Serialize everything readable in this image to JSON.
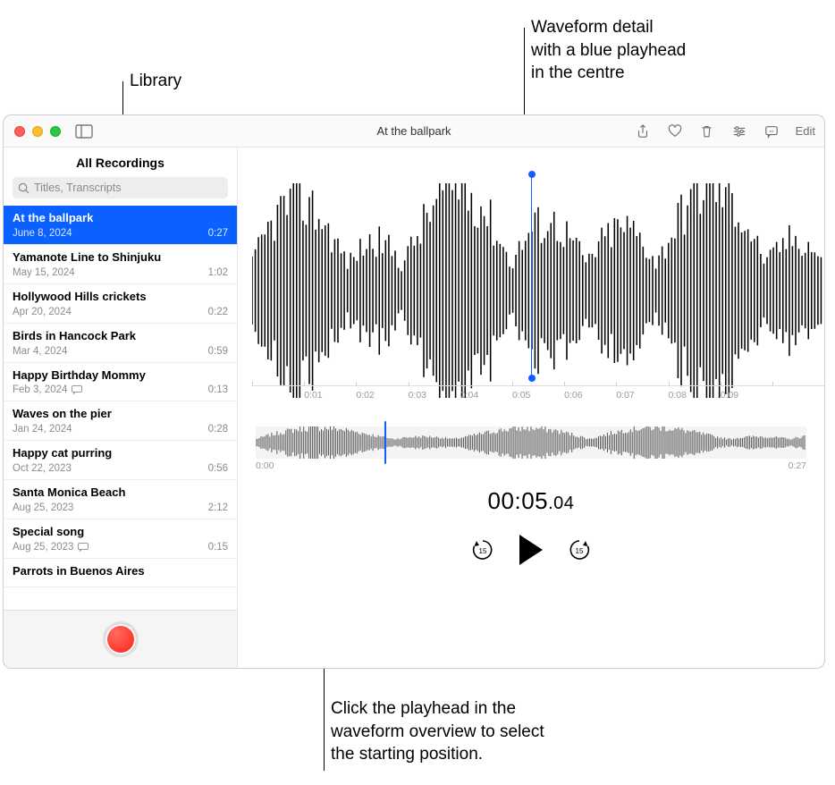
{
  "annotations": {
    "library": "Library",
    "waveform_detail": "Waveform detail\nwith a blue playhead\nin the centre",
    "overview_hint": "Click the playhead in the\nwaveform overview to select\nthe starting position."
  },
  "window": {
    "title": "At the ballpark",
    "edit_label": "Edit"
  },
  "sidebar": {
    "header": "All Recordings",
    "search_placeholder": "Titles, Transcripts",
    "recordings": [
      {
        "title": "At the ballpark",
        "date": "June 8, 2024",
        "duration": "0:27",
        "selected": true,
        "transcript": false
      },
      {
        "title": "Yamanote Line to Shinjuku",
        "date": "May 15, 2024",
        "duration": "1:02",
        "selected": false,
        "transcript": false
      },
      {
        "title": "Hollywood Hills crickets",
        "date": "Apr 20, 2024",
        "duration": "0:22",
        "selected": false,
        "transcript": false
      },
      {
        "title": "Birds in Hancock Park",
        "date": "Mar 4, 2024",
        "duration": "0:59",
        "selected": false,
        "transcript": false
      },
      {
        "title": "Happy Birthday Mommy",
        "date": "Feb 3, 2024",
        "duration": "0:13",
        "selected": false,
        "transcript": true
      },
      {
        "title": "Waves on the pier",
        "date": "Jan 24, 2024",
        "duration": "0:28",
        "selected": false,
        "transcript": false
      },
      {
        "title": "Happy cat purring",
        "date": "Oct 22, 2023",
        "duration": "0:56",
        "selected": false,
        "transcript": false
      },
      {
        "title": "Santa Monica Beach",
        "date": "Aug 25, 2023",
        "duration": "2:12",
        "selected": false,
        "transcript": false
      },
      {
        "title": "Special song",
        "date": "Aug 25, 2023",
        "duration": "0:15",
        "selected": false,
        "transcript": true
      },
      {
        "title": "Parrots in Buenos Aires",
        "date": "",
        "duration": "",
        "selected": false,
        "transcript": false
      }
    ]
  },
  "timeline": {
    "ticks": [
      "",
      "0:01",
      "0:02",
      "0:03",
      "0:04",
      "0:05",
      "0:06",
      "0:07",
      "0:08",
      "0:09",
      ""
    ]
  },
  "overview": {
    "start": "0:00",
    "end": "0:27"
  },
  "playback": {
    "time_main": "00:05",
    "time_frac": ".04",
    "skip_amount": "15"
  },
  "colors": {
    "accent": "#0a61ff",
    "record": "#ff3b30"
  }
}
